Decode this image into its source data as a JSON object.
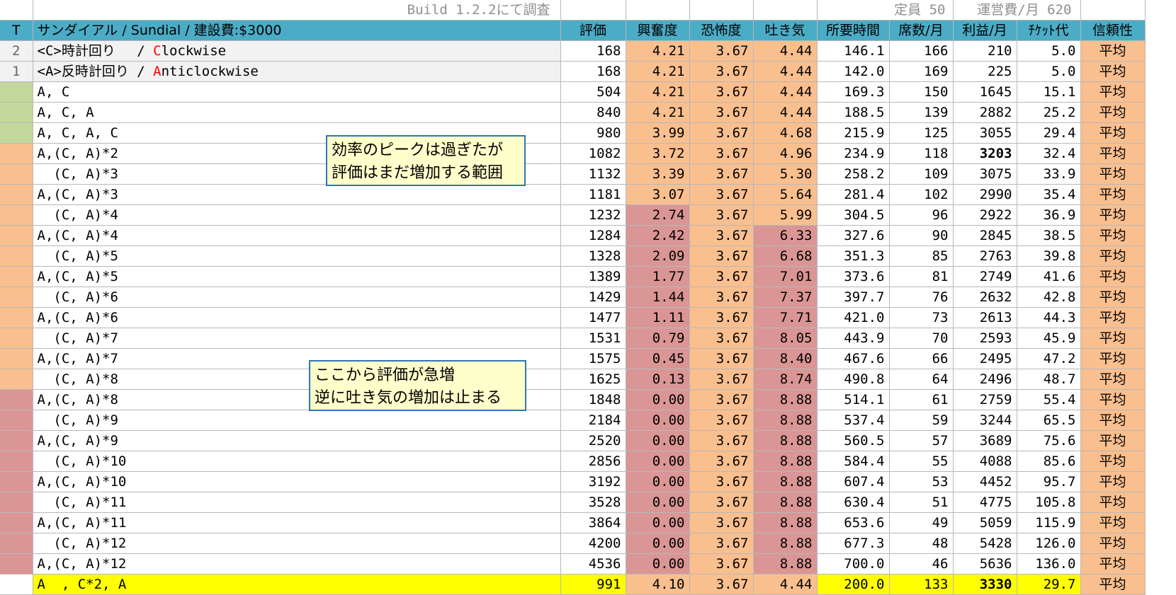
{
  "top": {
    "build": "Build 1.2.2にて調査",
    "capacity": "定員 50",
    "upkeep": "運営費/月 620"
  },
  "header": {
    "t": "T",
    "title": "サンダイアル / Sundial / 建設費:$3000",
    "cols": [
      "評価",
      "興奮度",
      "恐怖度",
      "吐き気",
      "所要時間",
      "席数/月",
      "利益/月",
      "ﾁｹｯﾄ代",
      "信頼性"
    ]
  },
  "rows": [
    {
      "t": "2",
      "pre": "<C>時計回り　 / ",
      "hl": "C",
      "post": "lockwise",
      "tc": "",
      "rating": "168",
      "ex": "4.21",
      "fe": "3.67",
      "na": "4.44",
      "time": "146.1",
      "seats": "166",
      "profit": "210",
      "ticket": "5.0",
      "rel": "平均",
      "exc": "pk",
      "nac": "pk",
      "gray": true
    },
    {
      "t": "1",
      "pre": "<A>反時計回り / ",
      "hl": "A",
      "post": "nticlockwise",
      "tc": "",
      "rating": "168",
      "ex": "4.21",
      "fe": "3.67",
      "na": "4.44",
      "time": "142.0",
      "seats": "169",
      "profit": "225",
      "ticket": "5.0",
      "rel": "平均",
      "exc": "pk",
      "nac": "pk",
      "gray": true
    },
    {
      "t": "",
      "name": "A, C",
      "tc": "gr",
      "rating": "504",
      "ex": "4.21",
      "fe": "3.67",
      "na": "4.44",
      "time": "169.3",
      "seats": "150",
      "profit": "1645",
      "ticket": "15.1",
      "rel": "平均",
      "exc": "pk",
      "nac": "pk"
    },
    {
      "t": "",
      "name": "A, C, A",
      "tc": "gr",
      "rating": "840",
      "ex": "4.21",
      "fe": "3.67",
      "na": "4.44",
      "time": "188.5",
      "seats": "139",
      "profit": "2882",
      "ticket": "25.2",
      "rel": "平均",
      "exc": "pk",
      "nac": "pk"
    },
    {
      "t": "",
      "name": "A, C, A, C",
      "tc": "gr",
      "rating": "980",
      "ex": "3.99",
      "fe": "3.67",
      "na": "4.68",
      "time": "215.9",
      "seats": "125",
      "profit": "3055",
      "ticket": "29.4",
      "rel": "平均",
      "exc": "pk",
      "nac": "pk"
    },
    {
      "t": "",
      "name": "A,(C, A)*2",
      "tc": "pk",
      "rating": "1082",
      "ex": "3.72",
      "fe": "3.67",
      "na": "4.96",
      "time": "234.9",
      "seats": "118",
      "profit": "3203",
      "ticket": "32.4",
      "rel": "平均",
      "exc": "pk",
      "nac": "pk",
      "pbold": true
    },
    {
      "t": "",
      "name": "  (C, A)*3",
      "tc": "pk",
      "rating": "1132",
      "ex": "3.39",
      "fe": "3.67",
      "na": "5.30",
      "time": "258.2",
      "seats": "109",
      "profit": "3075",
      "ticket": "33.9",
      "rel": "平均",
      "exc": "pk",
      "nac": "pk"
    },
    {
      "t": "",
      "name": "A,(C, A)*3",
      "tc": "pk",
      "rating": "1181",
      "ex": "3.07",
      "fe": "3.67",
      "na": "5.64",
      "time": "281.4",
      "seats": "102",
      "profit": "2990",
      "ticket": "35.4",
      "rel": "平均",
      "exc": "pk",
      "nac": "pk"
    },
    {
      "t": "",
      "name": "  (C, A)*4",
      "tc": "pk",
      "rating": "1232",
      "ex": "2.74",
      "fe": "3.67",
      "na": "5.99",
      "time": "304.5",
      "seats": "96",
      "profit": "2922",
      "ticket": "36.9",
      "rel": "平均",
      "exc": "rd",
      "nac": "pk"
    },
    {
      "t": "",
      "name": "A,(C, A)*4",
      "tc": "pk",
      "rating": "1284",
      "ex": "2.42",
      "fe": "3.67",
      "na": "6.33",
      "time": "327.6",
      "seats": "90",
      "profit": "2845",
      "ticket": "38.5",
      "rel": "平均",
      "exc": "rd",
      "nac": "rd"
    },
    {
      "t": "",
      "name": "  (C, A)*5",
      "tc": "pk",
      "rating": "1328",
      "ex": "2.09",
      "fe": "3.67",
      "na": "6.68",
      "time": "351.3",
      "seats": "85",
      "profit": "2763",
      "ticket": "39.8",
      "rel": "平均",
      "exc": "rd",
      "nac": "rd"
    },
    {
      "t": "",
      "name": "A,(C, A)*5",
      "tc": "pk",
      "rating": "1389",
      "ex": "1.77",
      "fe": "3.67",
      "na": "7.01",
      "time": "373.6",
      "seats": "81",
      "profit": "2749",
      "ticket": "41.6",
      "rel": "平均",
      "exc": "rd",
      "nac": "rd"
    },
    {
      "t": "",
      "name": "  (C, A)*6",
      "tc": "pk",
      "rating": "1429",
      "ex": "1.44",
      "fe": "3.67",
      "na": "7.37",
      "time": "397.7",
      "seats": "76",
      "profit": "2632",
      "ticket": "42.8",
      "rel": "平均",
      "exc": "rd",
      "nac": "rd"
    },
    {
      "t": "",
      "name": "A,(C, A)*6",
      "tc": "pk",
      "rating": "1477",
      "ex": "1.11",
      "fe": "3.67",
      "na": "7.71",
      "time": "421.0",
      "seats": "73",
      "profit": "2613",
      "ticket": "44.3",
      "rel": "平均",
      "exc": "rd",
      "nac": "rd"
    },
    {
      "t": "",
      "name": "  (C, A)*7",
      "tc": "pk",
      "rating": "1531",
      "ex": "0.79",
      "fe": "3.67",
      "na": "8.05",
      "time": "443.9",
      "seats": "70",
      "profit": "2593",
      "ticket": "45.9",
      "rel": "平均",
      "exc": "rd",
      "nac": "rd"
    },
    {
      "t": "",
      "name": "A,(C, A)*7",
      "tc": "pk",
      "rating": "1575",
      "ex": "0.45",
      "fe": "3.67",
      "na": "8.40",
      "time": "467.6",
      "seats": "66",
      "profit": "2495",
      "ticket": "47.2",
      "rel": "平均",
      "exc": "rd",
      "nac": "rd"
    },
    {
      "t": "",
      "name": "  (C, A)*8",
      "tc": "pk",
      "rating": "1625",
      "ex": "0.13",
      "fe": "3.67",
      "na": "8.74",
      "time": "490.8",
      "seats": "64",
      "profit": "2496",
      "ticket": "48.7",
      "rel": "平均",
      "exc": "rd",
      "nac": "rd"
    },
    {
      "t": "",
      "name": "A,(C, A)*8",
      "tc": "rd",
      "rating": "1848",
      "ex": "0.00",
      "fe": "3.67",
      "na": "8.88",
      "time": "514.1",
      "seats": "61",
      "profit": "2759",
      "ticket": "55.4",
      "rel": "平均",
      "exc": "rd",
      "nac": "rd"
    },
    {
      "t": "",
      "name": "  (C, A)*9",
      "tc": "rd",
      "rating": "2184",
      "ex": "0.00",
      "fe": "3.67",
      "na": "8.88",
      "time": "537.4",
      "seats": "59",
      "profit": "3244",
      "ticket": "65.5",
      "rel": "平均",
      "exc": "rd",
      "nac": "rd"
    },
    {
      "t": "",
      "name": "A,(C, A)*9",
      "tc": "rd",
      "rating": "2520",
      "ex": "0.00",
      "fe": "3.67",
      "na": "8.88",
      "time": "560.5",
      "seats": "57",
      "profit": "3689",
      "ticket": "75.6",
      "rel": "平均",
      "exc": "rd",
      "nac": "rd"
    },
    {
      "t": "",
      "name": "  (C, A)*10",
      "tc": "rd",
      "rating": "2856",
      "ex": "0.00",
      "fe": "3.67",
      "na": "8.88",
      "time": "584.4",
      "seats": "55",
      "profit": "4088",
      "ticket": "85.6",
      "rel": "平均",
      "exc": "rd",
      "nac": "rd"
    },
    {
      "t": "",
      "name": "A,(C, A)*10",
      "tc": "rd",
      "rating": "3192",
      "ex": "0.00",
      "fe": "3.67",
      "na": "8.88",
      "time": "607.4",
      "seats": "53",
      "profit": "4452",
      "ticket": "95.7",
      "rel": "平均",
      "exc": "rd",
      "nac": "rd"
    },
    {
      "t": "",
      "name": "  (C, A)*11",
      "tc": "rd",
      "rating": "3528",
      "ex": "0.00",
      "fe": "3.67",
      "na": "8.88",
      "time": "630.4",
      "seats": "51",
      "profit": "4775",
      "ticket": "105.8",
      "rel": "平均",
      "exc": "rd",
      "nac": "rd"
    },
    {
      "t": "",
      "name": "A,(C, A)*11",
      "tc": "rd",
      "rating": "3864",
      "ex": "0.00",
      "fe": "3.67",
      "na": "8.88",
      "time": "653.6",
      "seats": "49",
      "profit": "5059",
      "ticket": "115.9",
      "rel": "平均",
      "exc": "rd",
      "nac": "rd"
    },
    {
      "t": "",
      "name": "  (C, A)*12",
      "tc": "rd",
      "rating": "4200",
      "ex": "0.00",
      "fe": "3.67",
      "na": "8.88",
      "time": "677.3",
      "seats": "48",
      "profit": "5428",
      "ticket": "126.0",
      "rel": "平均",
      "exc": "rd",
      "nac": "rd"
    },
    {
      "t": "",
      "name": "A,(C, A)*12",
      "tc": "rd",
      "rating": "4536",
      "ex": "0.00",
      "fe": "3.67",
      "na": "8.88",
      "time": "700.0",
      "seats": "46",
      "profit": "5636",
      "ticket": "136.0",
      "rel": "平均",
      "exc": "rd",
      "nac": "rd"
    },
    {
      "t": "",
      "name": "A  , C*2, A",
      "tc": "",
      "rating": "991",
      "ex": "4.10",
      "fe": "3.67",
      "na": "4.44",
      "time": "200.0",
      "seats": "133",
      "profit": "3330",
      "ticket": "29.7",
      "rel": "平均",
      "exc": "pk",
      "nac": "pk",
      "yellow": true,
      "pred": true
    }
  ],
  "notes": {
    "n1_l1": "効率のピークは過ぎたが",
    "n1_l2": "評価はまだ増加する範囲",
    "n2_l1": "ここから評価が急増",
    "n2_l2": "逆に吐き気の増加は止まる"
  }
}
